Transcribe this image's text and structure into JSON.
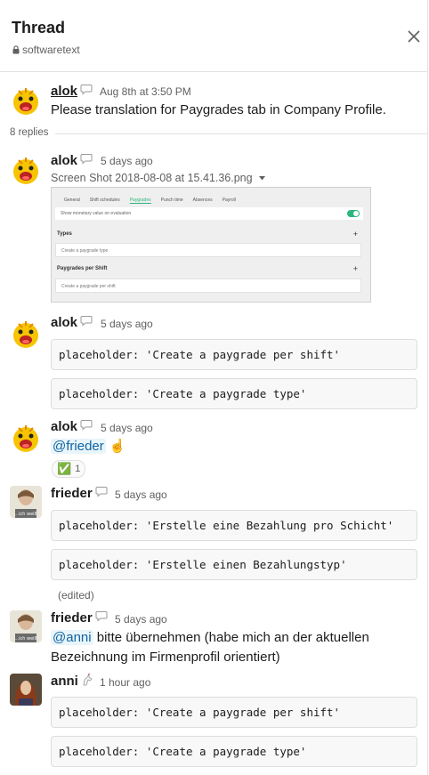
{
  "header": {
    "title": "Thread",
    "channel": "softwaretext"
  },
  "parent": {
    "author": "alok",
    "time": "Aug 8th at 3:50 PM",
    "text": "Please translation for Paygrades tab in Company Profile."
  },
  "replies_label": "8 replies",
  "messages": [
    {
      "author": "alok",
      "time": "5 days ago",
      "file_name": "Screen Shot 2018-08-08 at 15.41.36.png"
    },
    {
      "author": "alok",
      "time": "5 days ago",
      "code": [
        "placeholder: 'Create a paygrade per shift'",
        "placeholder: 'Create a paygrade type'"
      ]
    },
    {
      "author": "alok",
      "time": "5 days ago",
      "mention": "@frieder",
      "emoji": "☝️",
      "reaction": {
        "emoji": "✅",
        "count": "1"
      }
    },
    {
      "author": "frieder",
      "time": "5 days ago",
      "code": [
        "placeholder: 'Erstelle eine Bezahlung pro Schicht'",
        "placeholder: 'Erstelle einen Bezahlungstyp'"
      ],
      "edited": "(edited)"
    },
    {
      "author": "frieder",
      "time": "5 days ago",
      "mention": "@anni",
      "text": " bitte übernehmen (habe mich an der aktuellen Bezeichnung im Firmenprofil orientiert)"
    },
    {
      "author": "anni",
      "time": "1 hour ago",
      "code": [
        "placeholder: 'Create a paygrade per shift'",
        "placeholder: 'Create a paygrade type'"
      ]
    }
  ],
  "screenshot": {
    "tabs": [
      "General",
      "Shift schedules",
      "Paygrades",
      "Punch time",
      "Absences",
      "Payroll"
    ],
    "toggle_label": "Show monetary value on evaluation",
    "section1": "Types",
    "input1": "Create a paygrade type",
    "section2": "Paygrades per Shift",
    "input2": "Create a paygrade per shift",
    "plus": "+"
  },
  "colors": {
    "link": "#1264a3",
    "accent": "#2eb67d"
  }
}
